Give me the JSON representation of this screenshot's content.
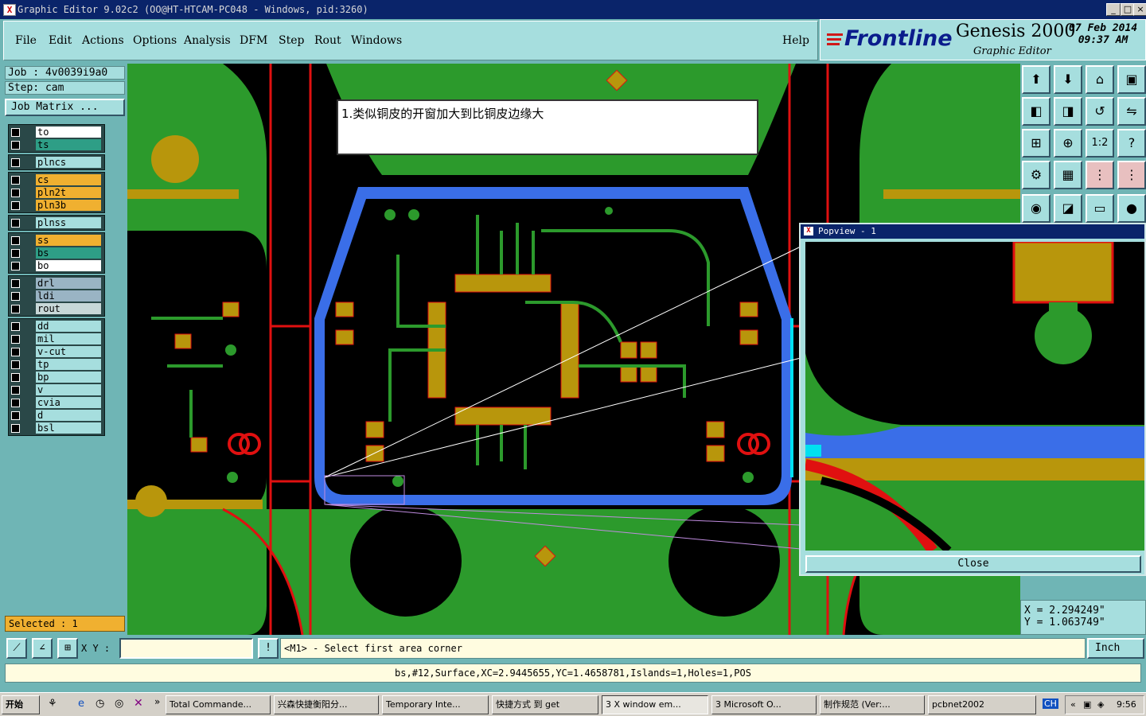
{
  "window": {
    "title": "Graphic Editor 9.02c2 (OO@HT-HTCAM-PC048 - Windows, pid:3260)",
    "minimize": "_",
    "maximize": "□",
    "close": "×"
  },
  "menu": {
    "items": [
      "File",
      "Edit",
      "Actions",
      "Options",
      "Analysis",
      "DFM",
      "Step",
      "Rout",
      "Windows"
    ],
    "help": "Help"
  },
  "brand": {
    "logo": "Frontline",
    "product": "Genesis 2000",
    "subtitle": "Graphic Editor",
    "date": "07 Feb 2014",
    "time": "09:37 AM"
  },
  "job": {
    "job_label": "Job : 4v0039i9a0",
    "step_label": "Step: cam",
    "matrix_button": "Job Matrix ..."
  },
  "layer_groups": [
    [
      {
        "name": "to",
        "color": "#ffffff"
      },
      {
        "name": "ts",
        "color": "#2e9e86"
      }
    ],
    [
      {
        "name": "plncs",
        "color": "#a6dede"
      }
    ],
    [
      {
        "name": "cs",
        "color": "#f0b030"
      },
      {
        "name": "pln2t",
        "color": "#f0b030"
      },
      {
        "name": "pln3b",
        "color": "#f0b030"
      }
    ],
    [
      {
        "name": "plnss",
        "color": "#a6dede"
      }
    ],
    [
      {
        "name": "ss",
        "color": "#f0b030"
      },
      {
        "name": "bs",
        "color": "#2e9e86"
      },
      {
        "name": "bo",
        "color": "#ffffff"
      }
    ],
    [
      {
        "name": "drl",
        "color": "#9ab4c4"
      },
      {
        "name": "ldi",
        "color": "#9ab4c4"
      },
      {
        "name": "rout",
        "color": "#c8d8d8"
      }
    ],
    [
      {
        "name": "dd",
        "color": "#a6dede"
      },
      {
        "name": "mil",
        "color": "#a6dede"
      },
      {
        "name": "v-cut",
        "color": "#a6dede"
      },
      {
        "name": "tp",
        "color": "#a6dede"
      },
      {
        "name": "bp",
        "color": "#a6dede"
      },
      {
        "name": "v",
        "color": "#a6dede"
      },
      {
        "name": "cvia",
        "color": "#a6dede"
      },
      {
        "name": "d",
        "color": "#a6dede"
      },
      {
        "name": "bsl",
        "color": "#a6dede"
      }
    ]
  ],
  "selected": "Selected : 1",
  "canvas": {
    "note": "1.类似铜皮的开窗加大到比铜皮边缘大"
  },
  "popview": {
    "title": "Popview - 1",
    "close": "Close"
  },
  "coords": {
    "x": "X = 2.294249\"",
    "y": "Y = 1.063749\""
  },
  "command": {
    "xy_label": "X Y :",
    "prompt": "<M1> - Select first area corner",
    "units": "Inch"
  },
  "status": "bs,#12,Surface,XC=2.9445655,YC=1.4658781,Islands=1,Holes=1,POS",
  "taskbar": {
    "start": "开始",
    "tasks": [
      "Total Commande...",
      "兴森快捷衡阳分...",
      "Temporary Inte...",
      "快捷方式 到 get",
      "3 X window em...",
      "3 Microsoft O...",
      "制作规范 (Ver:...",
      "pcbnet2002"
    ],
    "lang": "CH",
    "clock": "9:56"
  }
}
